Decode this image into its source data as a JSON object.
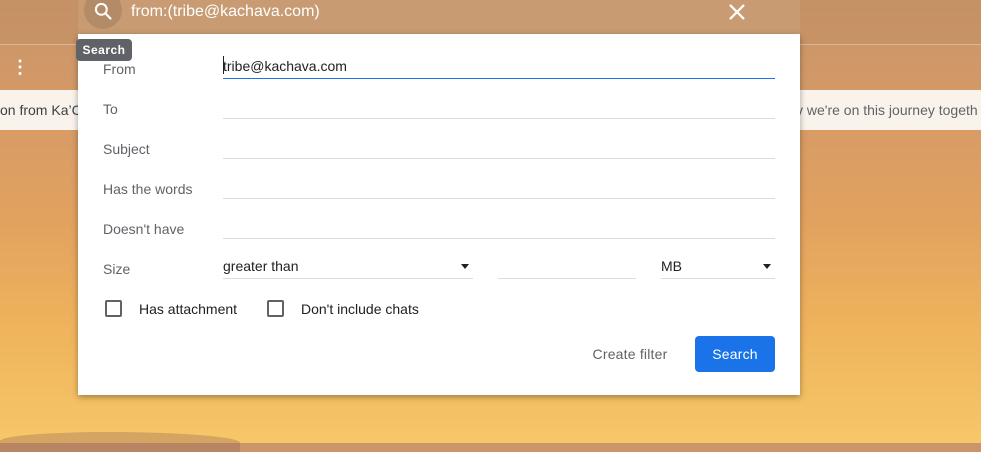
{
  "background": {
    "banner_left_text": "on from Ka’C",
    "banner_right_text": "v we're on this journey togeth",
    "more_icon": "more-vertical-icon"
  },
  "search_bar": {
    "query": "from:(tribe@kachava.com)",
    "tooltip": "Search",
    "search_icon": "search-icon",
    "close_icon": "close-icon"
  },
  "form": {
    "from_label": "From",
    "from_value": "tribe@kachava.com",
    "to_label": "To",
    "to_value": "",
    "subject_label": "Subject",
    "subject_value": "",
    "has_words_label": "Has the words",
    "has_words_value": "",
    "doesnt_have_label": "Doesn't have",
    "doesnt_have_value": "",
    "size_label": "Size",
    "size_operator": "greater than",
    "size_value": "",
    "size_unit": "MB",
    "has_attachment_label": "Has attachment",
    "has_attachment_checked": false,
    "dont_include_chats_label": "Don't include chats",
    "dont_include_chats_checked": false
  },
  "actions": {
    "create_filter_label": "Create filter",
    "search_label": "Search"
  },
  "colors": {
    "accent": "#1a73e8",
    "tooltip_bg": "#5f6368"
  }
}
